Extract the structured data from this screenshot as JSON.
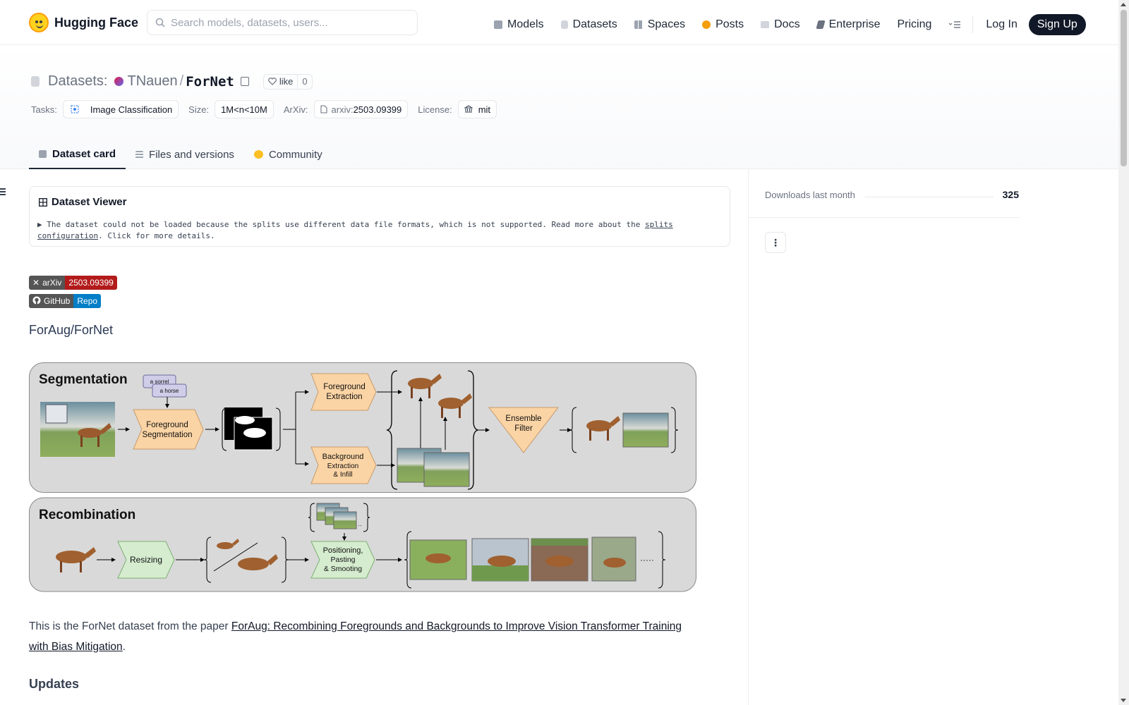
{
  "header": {
    "brand": "Hugging Face",
    "search_placeholder": "Search models, datasets, users...",
    "nav": [
      {
        "label": "Models",
        "icon": "cube-icon",
        "color": "#9ca3af"
      },
      {
        "label": "Datasets",
        "icon": "database-icon",
        "color": "#9ca3af"
      },
      {
        "label": "Spaces",
        "icon": "grid-icon",
        "color": "#9ca3af"
      },
      {
        "label": "Posts",
        "icon": "bubble-icon",
        "color": "#f59e0b"
      },
      {
        "label": "Docs",
        "icon": "book-icon",
        "color": "#9ca3af"
      },
      {
        "label": "Enterprise",
        "icon": "enterprise-icon",
        "color": "#6b7280"
      }
    ],
    "pricing": "Pricing",
    "login": "Log In",
    "signup": "Sign Up"
  },
  "repo": {
    "type_label": "Datasets:",
    "owner": "TNauen",
    "slash": "/",
    "name": "ForNet",
    "like_label": "like",
    "like_count": "0",
    "tags": {
      "tasks_label": "Tasks:",
      "tasks_value": "Image Classification",
      "size_label": "Size:",
      "size_value": "1M<n<10M",
      "arxiv_label": "ArXiv:",
      "arxiv_prefix": "arxiv:",
      "arxiv_value": "2503.09399",
      "license_label": "License:",
      "license_value": "mit"
    },
    "tabs": [
      {
        "label": "Dataset card",
        "active": true
      },
      {
        "label": "Files and versions",
        "active": false
      },
      {
        "label": "Community",
        "active": false
      }
    ]
  },
  "viewer": {
    "title": "Dataset Viewer",
    "message_prefix": "The dataset could not be loaded because the splits use different data file formats, which is not supported. Read more about the",
    "message_link": "splits configuration",
    "message_suffix": ". Click for more details."
  },
  "badges": {
    "arxiv_left": "arXiv",
    "arxiv_right": "2503.09399",
    "arxiv_color": "#b31b1b",
    "github_left": "GitHub",
    "github_right": "Repo",
    "github_color": "#007ec6"
  },
  "card": {
    "heading": "ForAug/ForNet",
    "para_prefix": "This is the ForNet dataset from the paper",
    "para_link": "ForAug: Recombining Foregrounds and Backgrounds to Improve Vision Transformer Training with Bias Mitigation",
    "para_suffix": ".",
    "updates_heading": "Updates"
  },
  "figure": {
    "seg_title": "Segmentation",
    "prompt_1": "a sorrel",
    "prompt_2": "a horse",
    "fg_seg_1": "Foreground",
    "fg_seg_2": "Segmentation",
    "fg_ext_1": "Foreground",
    "fg_ext_2": "Extraction",
    "bg_ext_1": "Background",
    "bg_ext_2": "Extraction",
    "bg_ext_3": "& Infill",
    "ens_1": "Ensemble",
    "ens_2": "Filter",
    "rec_title": "Recombination",
    "resize": "Resizing",
    "pos_1": "Positioning,",
    "pos_2": "Pasting",
    "pos_3": "& Smooting",
    "ellipsis": "·····"
  },
  "sidebar": {
    "downloads_label": "Downloads last month",
    "downloads_value": "325",
    "more_label": "⋮"
  }
}
